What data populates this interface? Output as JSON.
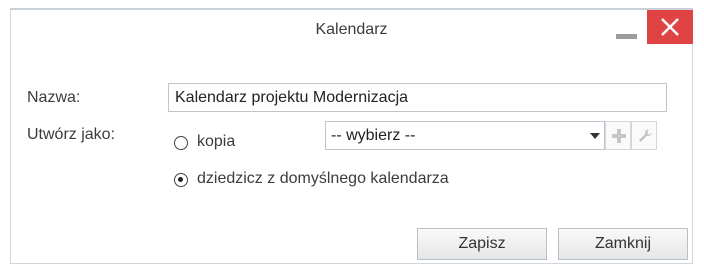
{
  "dialog": {
    "title": "Kalendarz",
    "minimize_icon": "minimize-icon",
    "close_icon": "close-icon",
    "close_color": "#e04343"
  },
  "form": {
    "name_label": "Nazwa:",
    "name_value": "Kalendarz projektu Modernizacja",
    "create_as_label": "Utwórz jako:",
    "options": [
      {
        "label": "kopia",
        "selected": false
      },
      {
        "label": "dziedzicz z domyślnego kalendarza",
        "selected": true
      }
    ],
    "calendar_select_value": "-- wybierz --",
    "add_icon": "plus-icon",
    "edit_icon": "wrench-icon"
  },
  "buttons": {
    "save": "Zapisz",
    "close": "Zamknij"
  }
}
